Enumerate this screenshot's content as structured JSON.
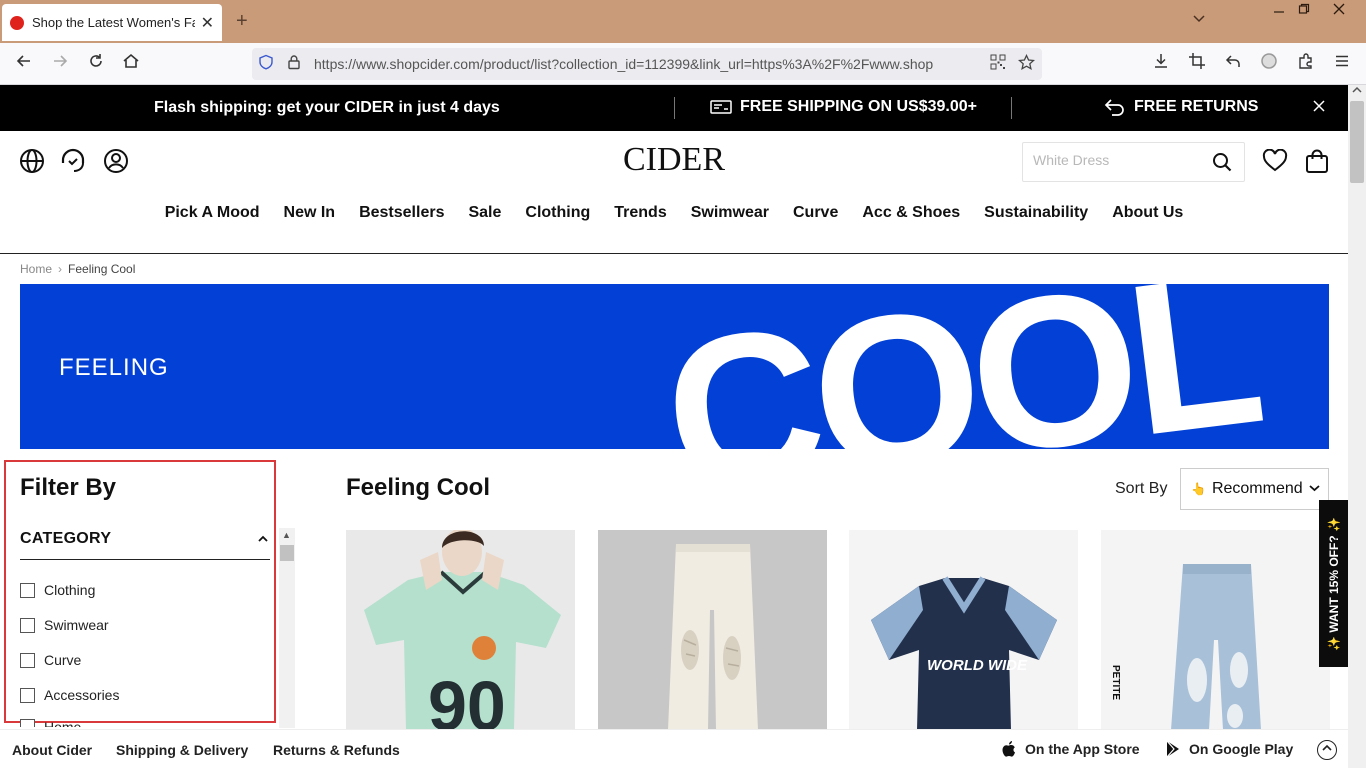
{
  "browser": {
    "tab_title": "Shop the Latest Women's Fashion",
    "tab_close": "✕",
    "new_tab": "+",
    "url": "https://www.shopcider.com/product/list?collection_id=112399&link_url=https%3A%2F%2Fwww.shop"
  },
  "promo": {
    "flash": "Flash shipping: get your CIDER in just 4 days",
    "shipping": "FREE SHIPPING ON US$39.00+",
    "returns": "FREE RETURNS"
  },
  "header": {
    "logo": "CIDER",
    "search_placeholder": "White Dress"
  },
  "nav": [
    "Pick A Mood",
    "New In",
    "Bestsellers",
    "Sale",
    "Clothing",
    "Trends",
    "Swimwear",
    "Curve",
    "Acc & Shoes",
    "Sustainability",
    "About Us"
  ],
  "breadcrumb": {
    "home": "Home",
    "current": "Feeling Cool"
  },
  "banner": {
    "small": "FEELING",
    "big": "COOL",
    "color": "#0341d6"
  },
  "filter": {
    "title": "Filter By",
    "category_label": "CATEGORY",
    "items": [
      "Clothing",
      "Swimwear",
      "Curve",
      "Accessories",
      "Home"
    ]
  },
  "main": {
    "title": "Feeling Cool",
    "sort_label": "Sort By",
    "sort_value": "Recommend"
  },
  "products": [
    {
      "image": "green-jersey-tee",
      "print": "90"
    },
    {
      "image": "white-ripped-jeans"
    },
    {
      "image": "navy-worldwide-jersey",
      "print": "WORLD WIDE"
    },
    {
      "image": "light-wash-ripped-jeans",
      "badge": "PETITE"
    }
  ],
  "side_promo": "✨ WANT 15% OFF? ✨",
  "footer": {
    "about": "About Cider",
    "shipping": "Shipping & Delivery",
    "returns": "Returns & Refunds",
    "app_store": "On the App Store",
    "google_play": "On Google Play"
  }
}
